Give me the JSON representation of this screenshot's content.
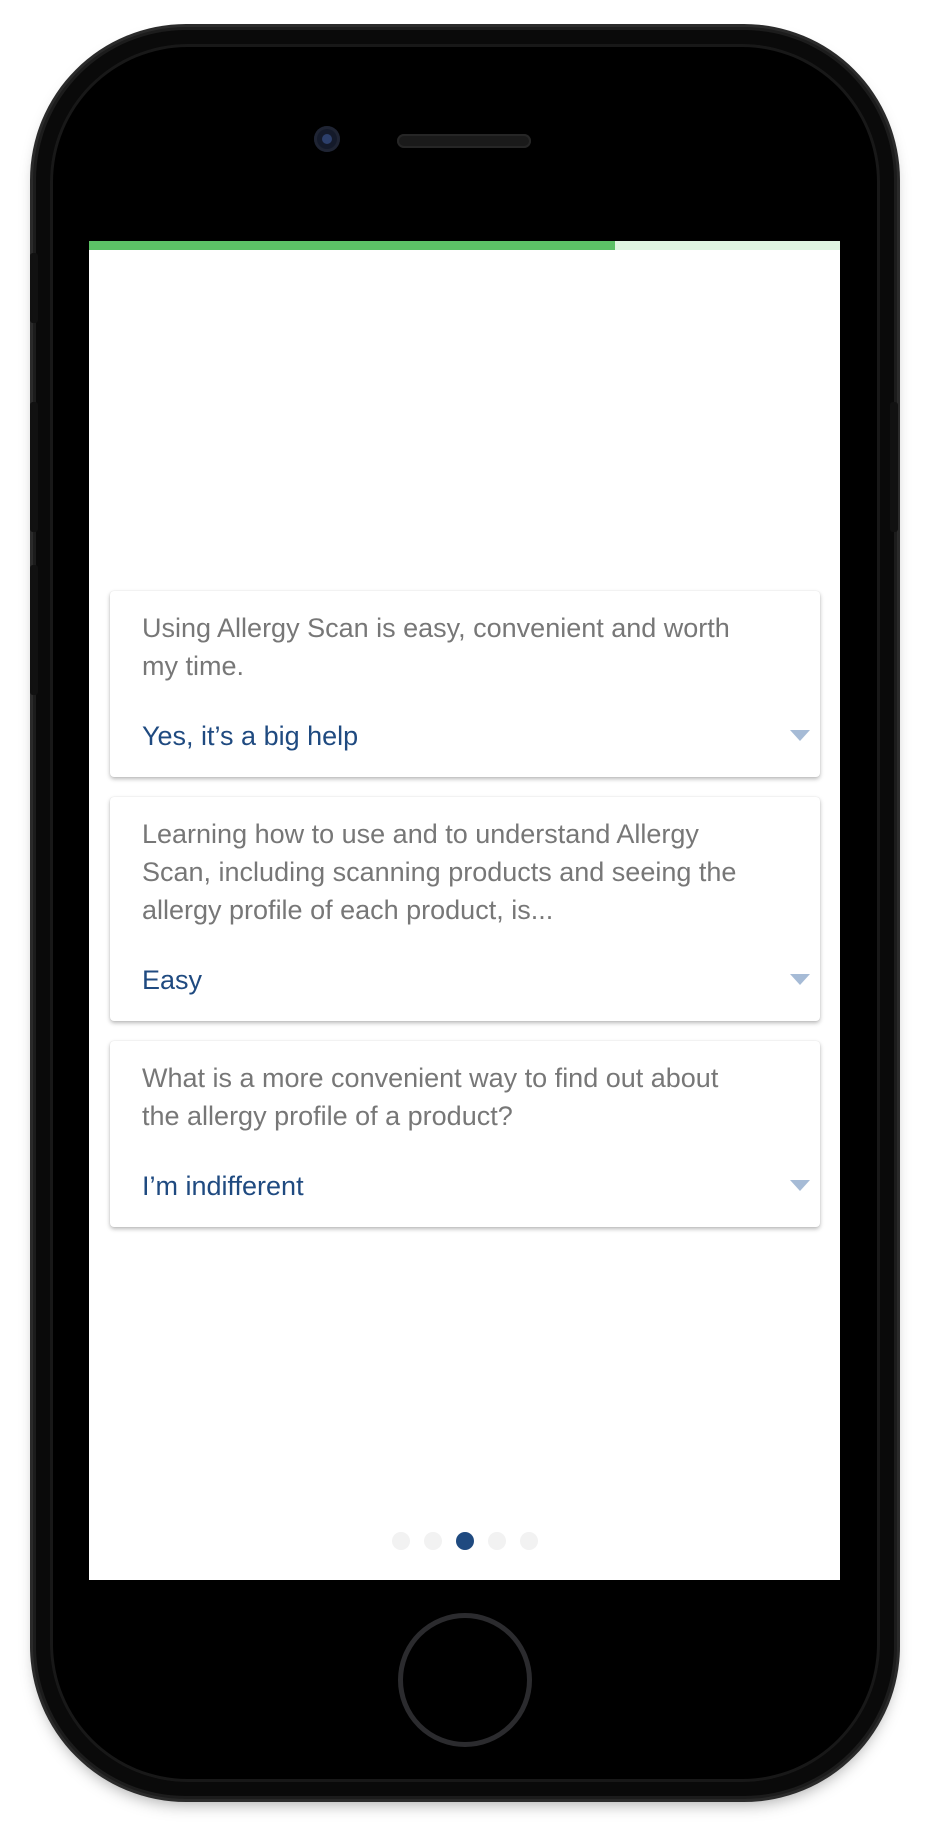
{
  "progress": {
    "fraction": 0.7
  },
  "survey": {
    "questions": [
      {
        "question": "Using Allergy Scan is easy, convenient and worth my time.",
        "answer": "Yes, it’s a big help"
      },
      {
        "question": "Learning how to use and to understand Allergy Scan, including scanning products and seeing the allergy profile of each product, is...",
        "answer": "Easy"
      },
      {
        "question": "What is a more convenient way to find out about the allergy profile of a product?",
        "answer": "I’m indifferent"
      }
    ]
  },
  "pager": {
    "count": 5,
    "active_index": 2
  },
  "colors": {
    "progress_fill": "#5cc166",
    "progress_track": "#dff5e1",
    "answer_text": "#1f4a80",
    "question_text": "#777777",
    "active_dot": "#1f4a80",
    "inactive_dot": "#f2f2f2"
  },
  "icons": {
    "dropdown": "chevron-down-icon",
    "camera": "front-camera-icon",
    "speaker": "earpiece-speaker-icon",
    "home": "home-button-icon"
  }
}
